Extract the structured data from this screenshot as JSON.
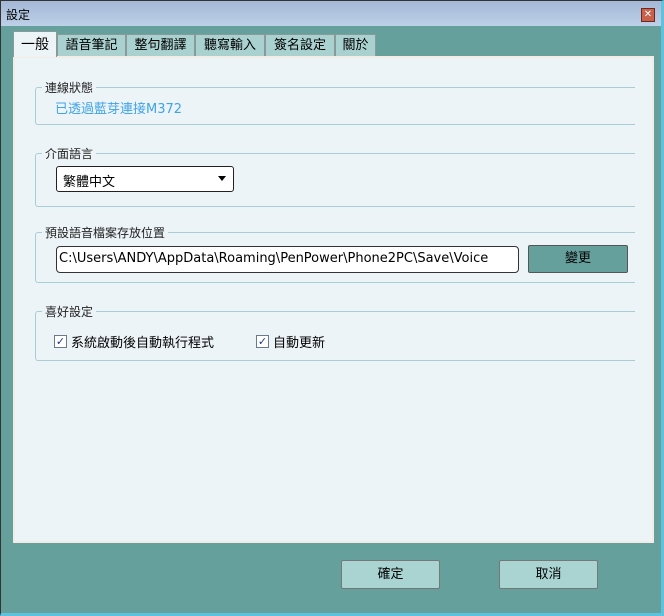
{
  "window": {
    "title": "設定",
    "close_icon": "close-icon"
  },
  "tabs": [
    {
      "label": "一般",
      "active": true
    },
    {
      "label": "語音筆記"
    },
    {
      "label": "整句翻譯"
    },
    {
      "label": "聽寫輸入"
    },
    {
      "label": "簽名設定"
    },
    {
      "label": "關於"
    }
  ],
  "connection": {
    "label": "連線狀態",
    "status": "已透過藍芽連接M372",
    "status_color": "#3fa3e8"
  },
  "language": {
    "label": "介面語言",
    "selected": "繁體中文"
  },
  "save_path": {
    "label": "預設語音檔案存放位置",
    "value": "C:\\Users\\ANDY\\AppData\\Roaming\\PenPower\\Phone2PC\\Save\\Voice",
    "change_label": "變更"
  },
  "prefs": {
    "label": "喜好設定",
    "autostart": {
      "label": "系統啟動後自動執行程式",
      "checked": true
    },
    "autoupdate": {
      "label": "自動更新",
      "checked": true
    }
  },
  "footer": {
    "ok": "確定",
    "cancel": "取消"
  }
}
